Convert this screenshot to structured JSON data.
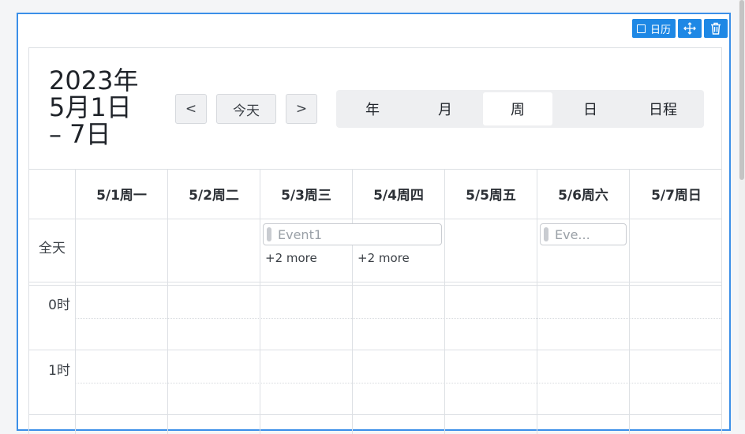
{
  "toolbar": {
    "calendar_label": "日历"
  },
  "header": {
    "range_line1": "2023年",
    "range_line2": "5月1日",
    "range_line3": "– 7日",
    "prev_label": "<",
    "today_label": "今天",
    "next_label": ">",
    "views": [
      "年",
      "月",
      "周",
      "日",
      "日程"
    ],
    "active_view": "周"
  },
  "days": [
    "5/1周一",
    "5/2周二",
    "5/3周三",
    "5/4周四",
    "5/5周五",
    "5/6周六",
    "5/7周日"
  ],
  "allday_label": "全天",
  "events": [
    {
      "title": "Event1",
      "start_day": "5/3周三",
      "end_day": "5/4周四"
    },
    {
      "title": "Eve...",
      "start_day": "5/6周六",
      "end_day": "5/6周六"
    }
  ],
  "more_links": [
    {
      "day": "5/3周三",
      "label": "+2 more"
    },
    {
      "day": "5/4周四",
      "label": "+2 more"
    }
  ],
  "time_labels": [
    "0时",
    "1时"
  ],
  "colors": {
    "accent": "#1e88e5",
    "frame_border": "#3b8fe8",
    "grid": "#dde0e4",
    "view_switch_bg": "#eeeff1"
  }
}
